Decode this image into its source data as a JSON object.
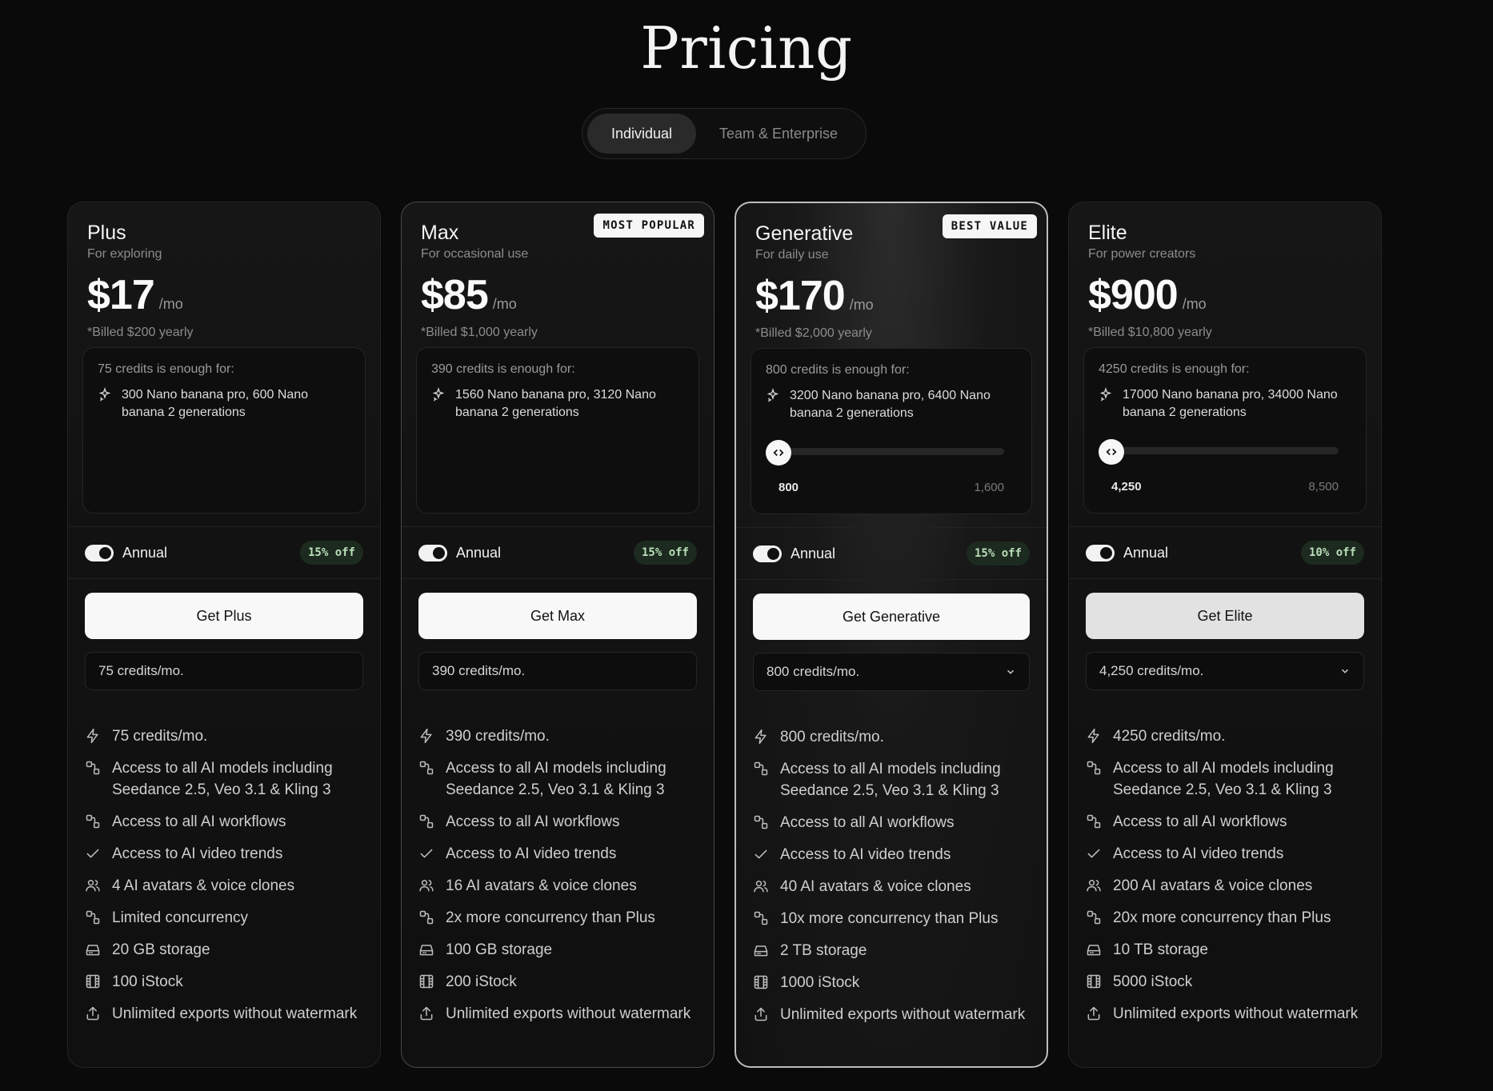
{
  "page": {
    "title": "Pricing"
  },
  "tabs": [
    {
      "label": "Individual",
      "active": true
    },
    {
      "label": "Team & Enterprise",
      "active": false
    }
  ],
  "plans": [
    {
      "name": "Plus",
      "subtitle": "For exploring",
      "price": "$17",
      "period": "/mo",
      "billed": "*Billed $200 yearly",
      "badge": "",
      "credit_box": {
        "title": "75 credits is enough for:",
        "line": "300 Nano banana pro, 600 Nano banana 2 generations"
      },
      "toggle_label": "Annual",
      "discount": "15% off",
      "cta": "Get Plus",
      "credits_select": "75 credits/mo.",
      "features": [
        {
          "icon": "bolt-icon",
          "text": "75 credits/mo."
        },
        {
          "icon": "workflow-icon",
          "text": "Access to all AI models including Seedance 2.5, Veo 3.1 & Kling 3"
        },
        {
          "icon": "workflow-icon",
          "text": "Access to all AI workflows"
        },
        {
          "icon": "check-icon",
          "text": "Access to AI video trends"
        },
        {
          "icon": "users-icon",
          "text": "4 AI avatars & voice clones"
        },
        {
          "icon": "workflow-icon",
          "text": "Limited concurrency"
        },
        {
          "icon": "storage-icon",
          "text": "20 GB storage"
        },
        {
          "icon": "film-icon",
          "text": "100 iStock"
        },
        {
          "icon": "export-icon",
          "text": "Unlimited exports without watermark"
        }
      ]
    },
    {
      "name": "Max",
      "subtitle": "For occasional use",
      "price": "$85",
      "period": "/mo",
      "billed": "*Billed $1,000 yearly",
      "badge": "MOST POPULAR",
      "credit_box": {
        "title": "390 credits is enough for:",
        "line": "1560 Nano banana pro, 3120 Nano banana 2 generations"
      },
      "toggle_label": "Annual",
      "discount": "15% off",
      "cta": "Get Max",
      "credits_select": "390 credits/mo.",
      "features": [
        {
          "icon": "bolt-icon",
          "text": "390 credits/mo."
        },
        {
          "icon": "workflow-icon",
          "text": "Access to all AI models including Seedance 2.5, Veo 3.1 & Kling 3"
        },
        {
          "icon": "workflow-icon",
          "text": "Access to all AI workflows"
        },
        {
          "icon": "check-icon",
          "text": "Access to AI video trends"
        },
        {
          "icon": "users-icon",
          "text": "16 AI avatars & voice clones"
        },
        {
          "icon": "workflow-icon",
          "text": "2x more concurrency than Plus"
        },
        {
          "icon": "storage-icon",
          "text": "100 GB storage"
        },
        {
          "icon": "film-icon",
          "text": "200 iStock"
        },
        {
          "icon": "export-icon",
          "text": "Unlimited exports without watermark"
        }
      ]
    },
    {
      "name": "Generative",
      "subtitle": "For daily use",
      "price": "$170",
      "period": "/mo",
      "billed": "*Billed $2,000 yearly",
      "badge": "BEST VALUE",
      "credit_box": {
        "title": "800 credits is enough for:",
        "line": "3200 Nano banana pro, 6400 Nano banana 2 generations",
        "slider_min": "800",
        "slider_max": "1,600"
      },
      "toggle_label": "Annual",
      "discount": "15% off",
      "cta": "Get Generative",
      "credits_select": "800 credits/mo.",
      "features": [
        {
          "icon": "bolt-icon",
          "text": "800 credits/mo."
        },
        {
          "icon": "workflow-icon",
          "text": "Access to all AI models including Seedance 2.5, Veo 3.1 & Kling 3"
        },
        {
          "icon": "workflow-icon",
          "text": "Access to all AI workflows"
        },
        {
          "icon": "check-icon",
          "text": "Access to AI video trends"
        },
        {
          "icon": "users-icon",
          "text": "40 AI avatars & voice clones"
        },
        {
          "icon": "workflow-icon",
          "text": "10x more concurrency than Plus"
        },
        {
          "icon": "storage-icon",
          "text": "2 TB storage"
        },
        {
          "icon": "film-icon",
          "text": "1000 iStock"
        },
        {
          "icon": "export-icon",
          "text": "Unlimited exports without watermark"
        }
      ]
    },
    {
      "name": "Elite",
      "subtitle": "For power creators",
      "price": "$900",
      "period": "/mo",
      "billed": "*Billed $10,800 yearly",
      "badge": "",
      "credit_box": {
        "title": "4250 credits is enough for:",
        "line": "17000 Nano banana pro, 34000 Nano banana 2 generations",
        "slider_min": "4,250",
        "slider_max": "8,500"
      },
      "toggle_label": "Annual",
      "discount": "10% off",
      "cta": "Get Elite",
      "credits_select": "4,250 credits/mo.",
      "features": [
        {
          "icon": "bolt-icon",
          "text": "4250 credits/mo."
        },
        {
          "icon": "workflow-icon",
          "text": "Access to all AI models including Seedance 2.5, Veo 3.1 & Kling 3"
        },
        {
          "icon": "workflow-icon",
          "text": "Access to all AI workflows"
        },
        {
          "icon": "check-icon",
          "text": "Access to AI video trends"
        },
        {
          "icon": "users-icon",
          "text": "200 AI avatars & voice clones"
        },
        {
          "icon": "workflow-icon",
          "text": "20x more concurrency than Plus"
        },
        {
          "icon": "storage-icon",
          "text": "10 TB storage"
        },
        {
          "icon": "film-icon",
          "text": "5000 iStock"
        },
        {
          "icon": "export-icon",
          "text": "Unlimited exports without watermark"
        }
      ]
    }
  ],
  "colors": {
    "background": "#0a0a0a",
    "discount_bg": "#1d2a1f",
    "discount_text": "#b9dfb9",
    "highlight_border": "#bdbdbd"
  }
}
